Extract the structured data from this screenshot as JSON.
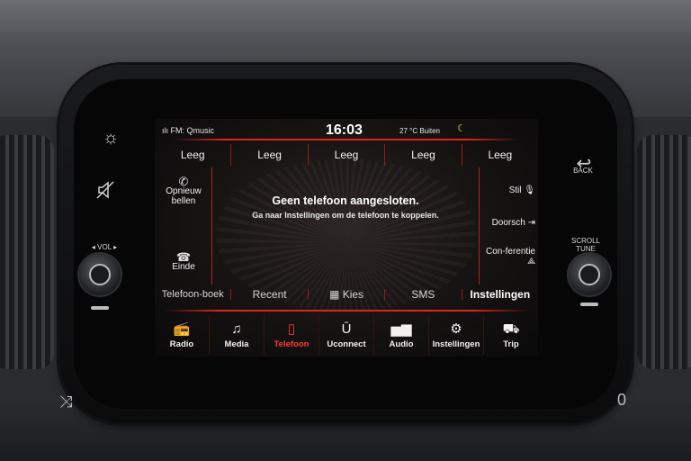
{
  "status": {
    "radio": "FM: Qmusic",
    "clock": "16:03",
    "temperature": "27 °C Buiten"
  },
  "favorites": [
    "Leeg",
    "Leeg",
    "Leeg",
    "Leeg",
    "Leeg"
  ],
  "left_actions": {
    "redial": "Opnieuw bellen",
    "end": "Einde"
  },
  "right_actions": {
    "mute": "Stil",
    "transfer": "Doorsch",
    "conference": "Con-ferentie"
  },
  "message": {
    "title": "Geen telefoon aangesloten.",
    "subtitle": "Ga naar Instellingen om de telefoon te koppelen."
  },
  "phone_tabs": {
    "phonebook": "Telefoon-boek",
    "recent": "Recent",
    "dial": "Kies",
    "sms": "SMS",
    "settings": "Instellingen"
  },
  "nav": {
    "radio": "Radio",
    "media": "Media",
    "phone": "Telefoon",
    "uconnect": "Uconnect",
    "audio": "Audio",
    "settings": "Instellingen",
    "trip": "Trip"
  },
  "hardware": {
    "back": "BACK",
    "vol": "VOL",
    "scroll_tune": "SCROLL TUNE"
  },
  "colors": {
    "accent_red": "#e1231b",
    "active_tab": "#ff3b2f",
    "status_icon": "#c7e23a"
  },
  "icons": {
    "brightness": "sun-icon",
    "screen_off": "screen-off-icon",
    "back": "back-arrow-icon",
    "phone": "phone-icon",
    "mute_mic": "mic-mute-icon",
    "transfer": "transfer-icon",
    "conference": "conference-icon",
    "keypad": "keypad-icon"
  }
}
